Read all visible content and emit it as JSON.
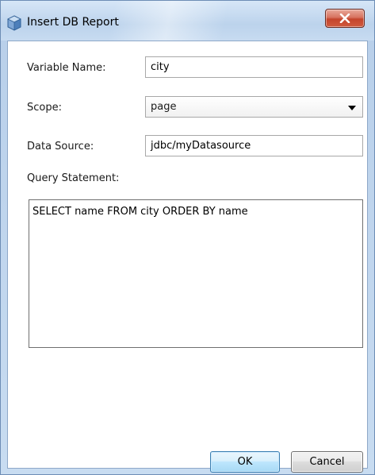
{
  "window": {
    "title": "Insert DB Report",
    "icon": "netbeans-cube-icon",
    "close_icon": "close-x-icon"
  },
  "form": {
    "variable_name": {
      "label": "Variable Name:",
      "value": "city"
    },
    "scope": {
      "label": "Scope:",
      "value": "page"
    },
    "data_source": {
      "label": "Data Source:",
      "value": "jdbc/myDatasource"
    },
    "query_statement": {
      "label": "Query Statement:",
      "value": "SELECT name FROM city ORDER BY name"
    }
  },
  "buttons": {
    "ok_label": "OK",
    "cancel_label": "Cancel"
  },
  "colors": {
    "close_button": "#c4452c",
    "ok_button_border": "#3c7fb1",
    "window_frame": "#b9d0ea"
  }
}
